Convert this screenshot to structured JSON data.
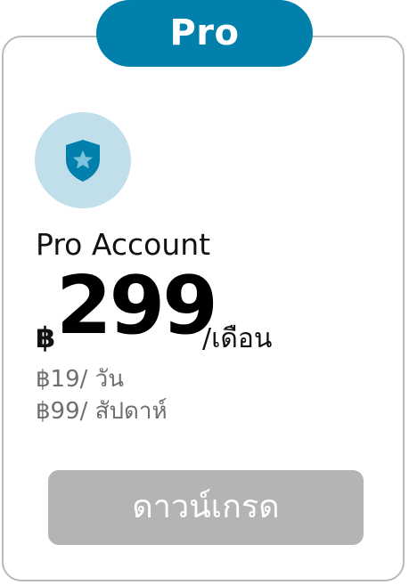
{
  "badge": {
    "label": "Pro"
  },
  "plan": {
    "name": "Pro Account",
    "currency": "฿",
    "amount": "299",
    "period": "/เดือน",
    "daily": "฿19/ วัน",
    "weekly": "฿99/ สัปดาห์"
  },
  "action": {
    "label": "ดาวน์เกรด"
  },
  "colors": {
    "brand": "#0180ac",
    "icon_bg": "#c1dfea",
    "button_disabled": "#b4b4b4",
    "border": "#b9b9b9"
  },
  "icons": {
    "plan_icon": "shield-star-icon"
  }
}
